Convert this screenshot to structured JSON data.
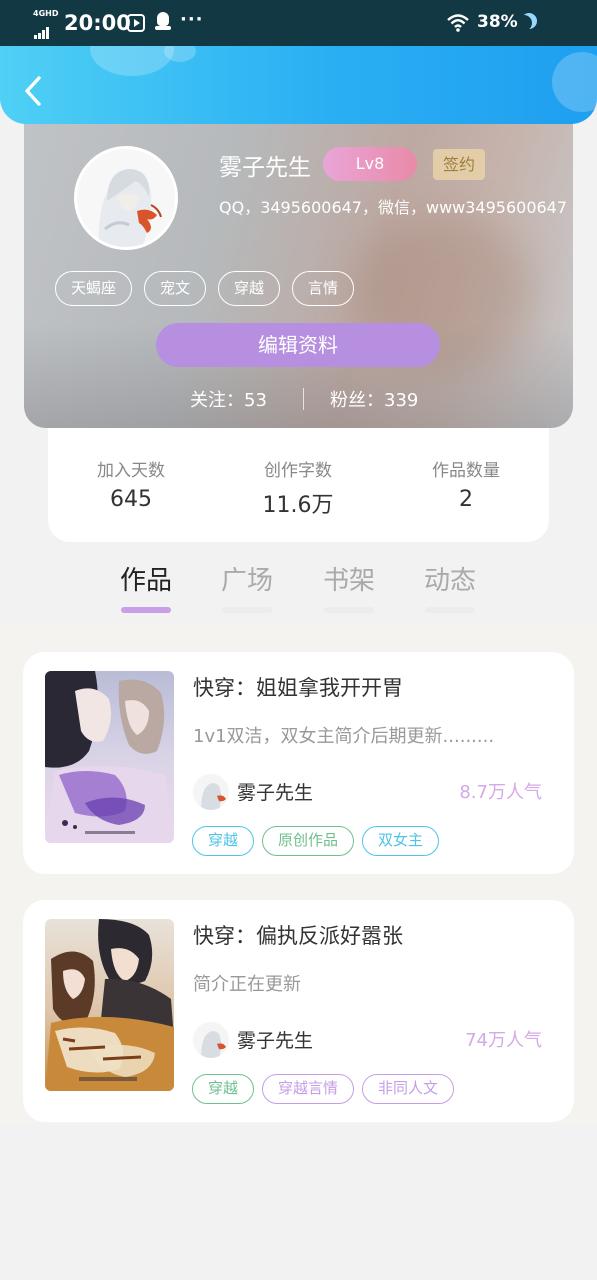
{
  "status_bar": {
    "network": "4GHD",
    "time": "20:00",
    "more": "···",
    "battery": "38%"
  },
  "profile": {
    "username": "雾子先生",
    "level": "Lv8",
    "signed": "签约",
    "contact": "QQ，3495600647，微信，www3495600647",
    "tags": [
      "天蝎座",
      "宠文",
      "穿越",
      "言情"
    ],
    "edit_label": "编辑资料",
    "following": "关注：53",
    "followers": "粉丝：339"
  },
  "stats": [
    {
      "label": "加入天数",
      "value": "645"
    },
    {
      "label": "创作字数",
      "value": "11.6万"
    },
    {
      "label": "作品数量",
      "value": "2"
    }
  ],
  "tabs": [
    "作品",
    "广场",
    "书架",
    "动态"
  ],
  "active_tab": 0,
  "works": [
    {
      "title": "快穿：姐姐拿我开开胃",
      "desc": "1v1双洁，双女主简介后期更新.........",
      "author": "雾子先生",
      "popularity": "8.7万人气",
      "tags": [
        {
          "label": "穿越",
          "color": "blue"
        },
        {
          "label": "原创作品",
          "color": "green"
        },
        {
          "label": "双女主",
          "color": "blue"
        }
      ]
    },
    {
      "title": "快穿：偏执反派好嚣张",
      "desc": "简介正在更新",
      "author": "雾子先生",
      "popularity": "74万人气",
      "tags": [
        {
          "label": "穿越",
          "color": "green"
        },
        {
          "label": "穿越言情",
          "color": "purple"
        },
        {
          "label": "非同人文",
          "color": "purple"
        }
      ]
    }
  ]
}
